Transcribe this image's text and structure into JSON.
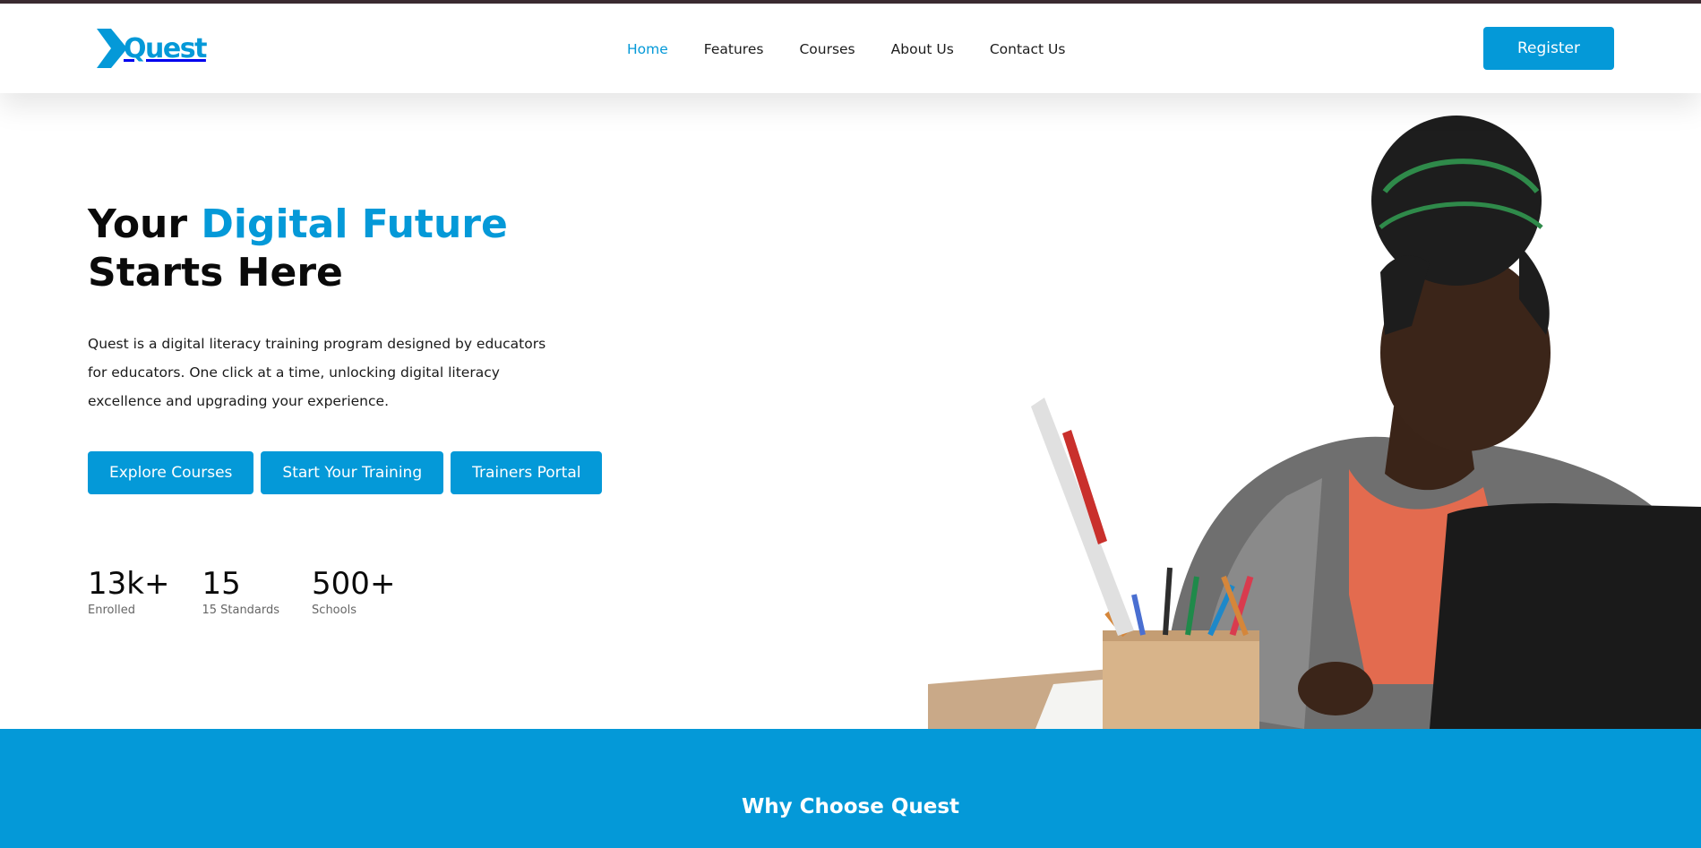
{
  "header": {
    "logo_text": "Quest",
    "nav": [
      {
        "label": "Home",
        "active": true
      },
      {
        "label": "Features",
        "active": false
      },
      {
        "label": "Courses",
        "active": false
      },
      {
        "label": "About Us",
        "active": false
      },
      {
        "label": "Contact Us",
        "active": false
      }
    ],
    "register_label": "Register"
  },
  "hero": {
    "title_prefix": "Your ",
    "title_accent": "Digital Future",
    "title_line2": "Starts Here",
    "description": "Quest is a digital literacy training program designed by educators for educators. One click at a time, unlocking digital literacy excellence and upgrading your experience.",
    "buttons": [
      "Explore Courses",
      "Start Your Training",
      "Trainers Portal"
    ],
    "stats": [
      {
        "value": "13k+",
        "label": "Enrolled"
      },
      {
        "value": "15",
        "label": "15 Standards"
      },
      {
        "value": "500+",
        "label": "Schools"
      }
    ]
  },
  "why": {
    "title": "Why Choose Quest"
  },
  "colors": {
    "accent": "#0499d8",
    "top_line": "#3b2b31"
  }
}
